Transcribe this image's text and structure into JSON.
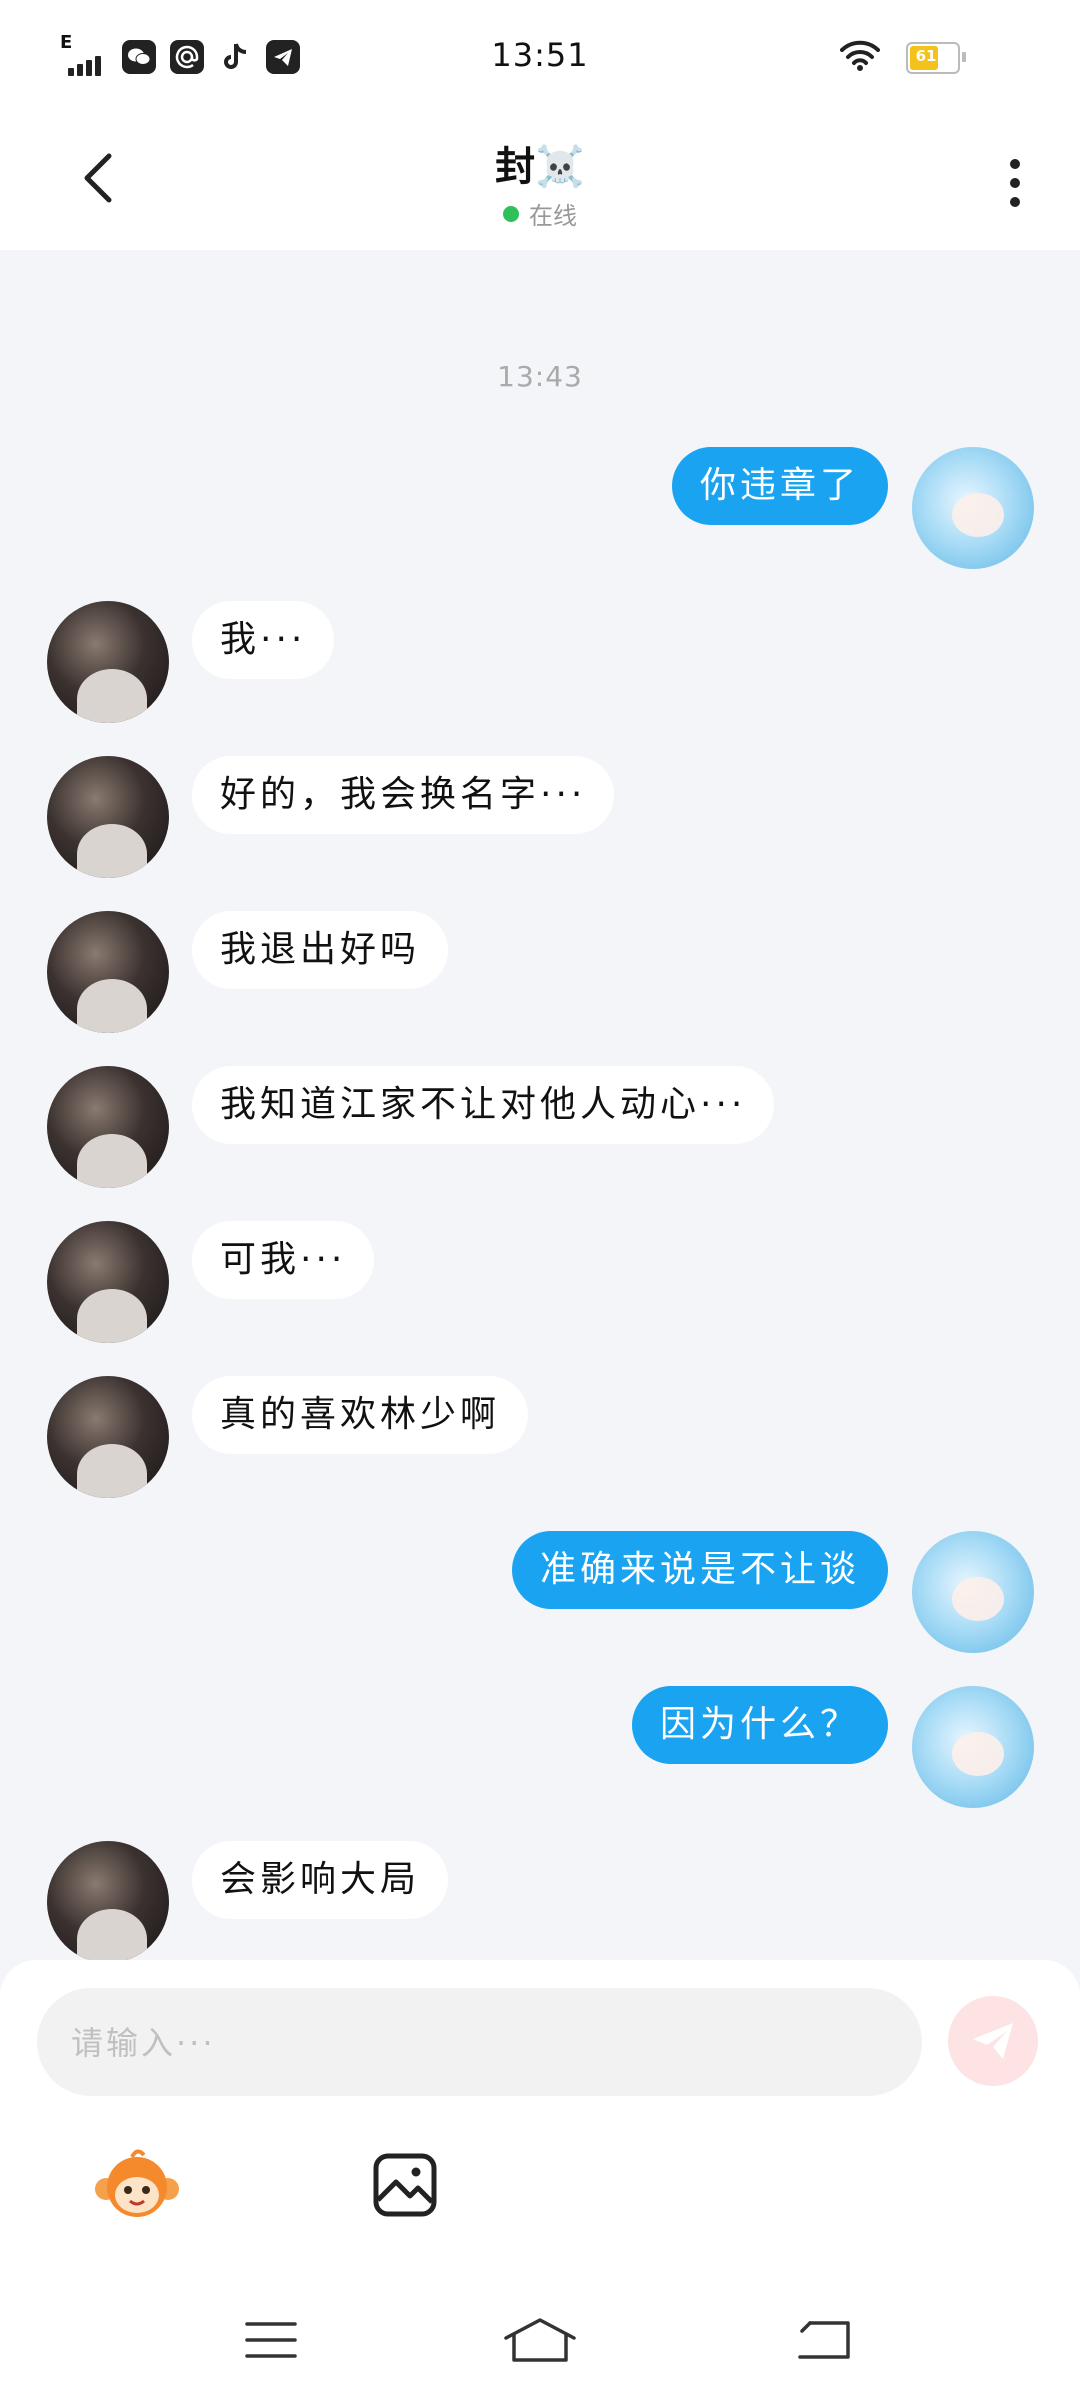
{
  "status_bar": {
    "time": "13:51",
    "signal_label": "E",
    "battery_percent": "61",
    "app_icons": [
      "wechat-icon",
      "at-icon",
      "tiktok-icon",
      "telegram-icon"
    ]
  },
  "header": {
    "title": "封☠️",
    "status_text": "在线",
    "status_color": "#2fc05a"
  },
  "chat": {
    "timestamp": "13:43",
    "messages": [
      {
        "from": "me",
        "text": "你违章了"
      },
      {
        "from": "other",
        "text": "我···"
      },
      {
        "from": "other",
        "text": "好的，我会换名字···"
      },
      {
        "from": "other",
        "text": "我退出好吗"
      },
      {
        "from": "other",
        "text": "我知道江家不让对他人动心···"
      },
      {
        "from": "other",
        "text": "可我···"
      },
      {
        "from": "other",
        "text": "真的喜欢林少啊"
      },
      {
        "from": "me",
        "text": "准确来说是不让谈"
      },
      {
        "from": "me",
        "text": "因为什么？"
      },
      {
        "from": "other",
        "text": "会影响大局"
      }
    ]
  },
  "input": {
    "placeholder": "请输入···",
    "value": ""
  },
  "colors": {
    "my_bubble": "#1aa3f0",
    "other_bubble": "#ffffff",
    "send_button": "#fde3e3",
    "background": "#f3f5f8"
  }
}
